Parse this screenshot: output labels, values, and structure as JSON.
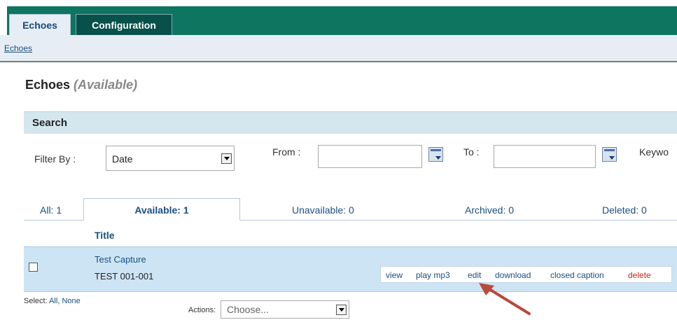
{
  "top_tabs": {
    "echoes": "Echoes",
    "configuration": "Configuration"
  },
  "sub_nav": {
    "echoes_link": "Echoes"
  },
  "page": {
    "title": "Echoes",
    "status": "(Available)"
  },
  "search": {
    "header": "Search",
    "filter_label": "Filter By :",
    "filter_value": "Date",
    "from_label": "From :",
    "to_label": "To :",
    "keyword_label": "Keywo"
  },
  "status_tabs": {
    "all": "All: 1",
    "available": "Available: 1",
    "unavailable": "Unavailable: 0",
    "archived": "Archived: 0",
    "deleted": "Deleted: 0"
  },
  "table": {
    "column_title": "Title",
    "row": {
      "title": "Test Capture",
      "course": "TEST 001-001",
      "actions": {
        "view": "view",
        "play_mp3": "play mp3",
        "edit": "edit",
        "download": "download",
        "closed_caption": "closed caption",
        "delete": "delete"
      }
    }
  },
  "footer": {
    "select_label": "Select:",
    "select_all": "All",
    "select_none": "None",
    "actions_label": "Actions:",
    "actions_placeholder": "Choose..."
  },
  "colors": {
    "header_green": "#0d7560",
    "link_blue": "#1a4f80",
    "row_highlight": "#cde4f5",
    "delete_red": "#d0261c",
    "annotation_arrow": "#b84a3c"
  },
  "icons": [
    "calendar-icon",
    "dropdown-arrow-icon",
    "annotation-arrow"
  ]
}
